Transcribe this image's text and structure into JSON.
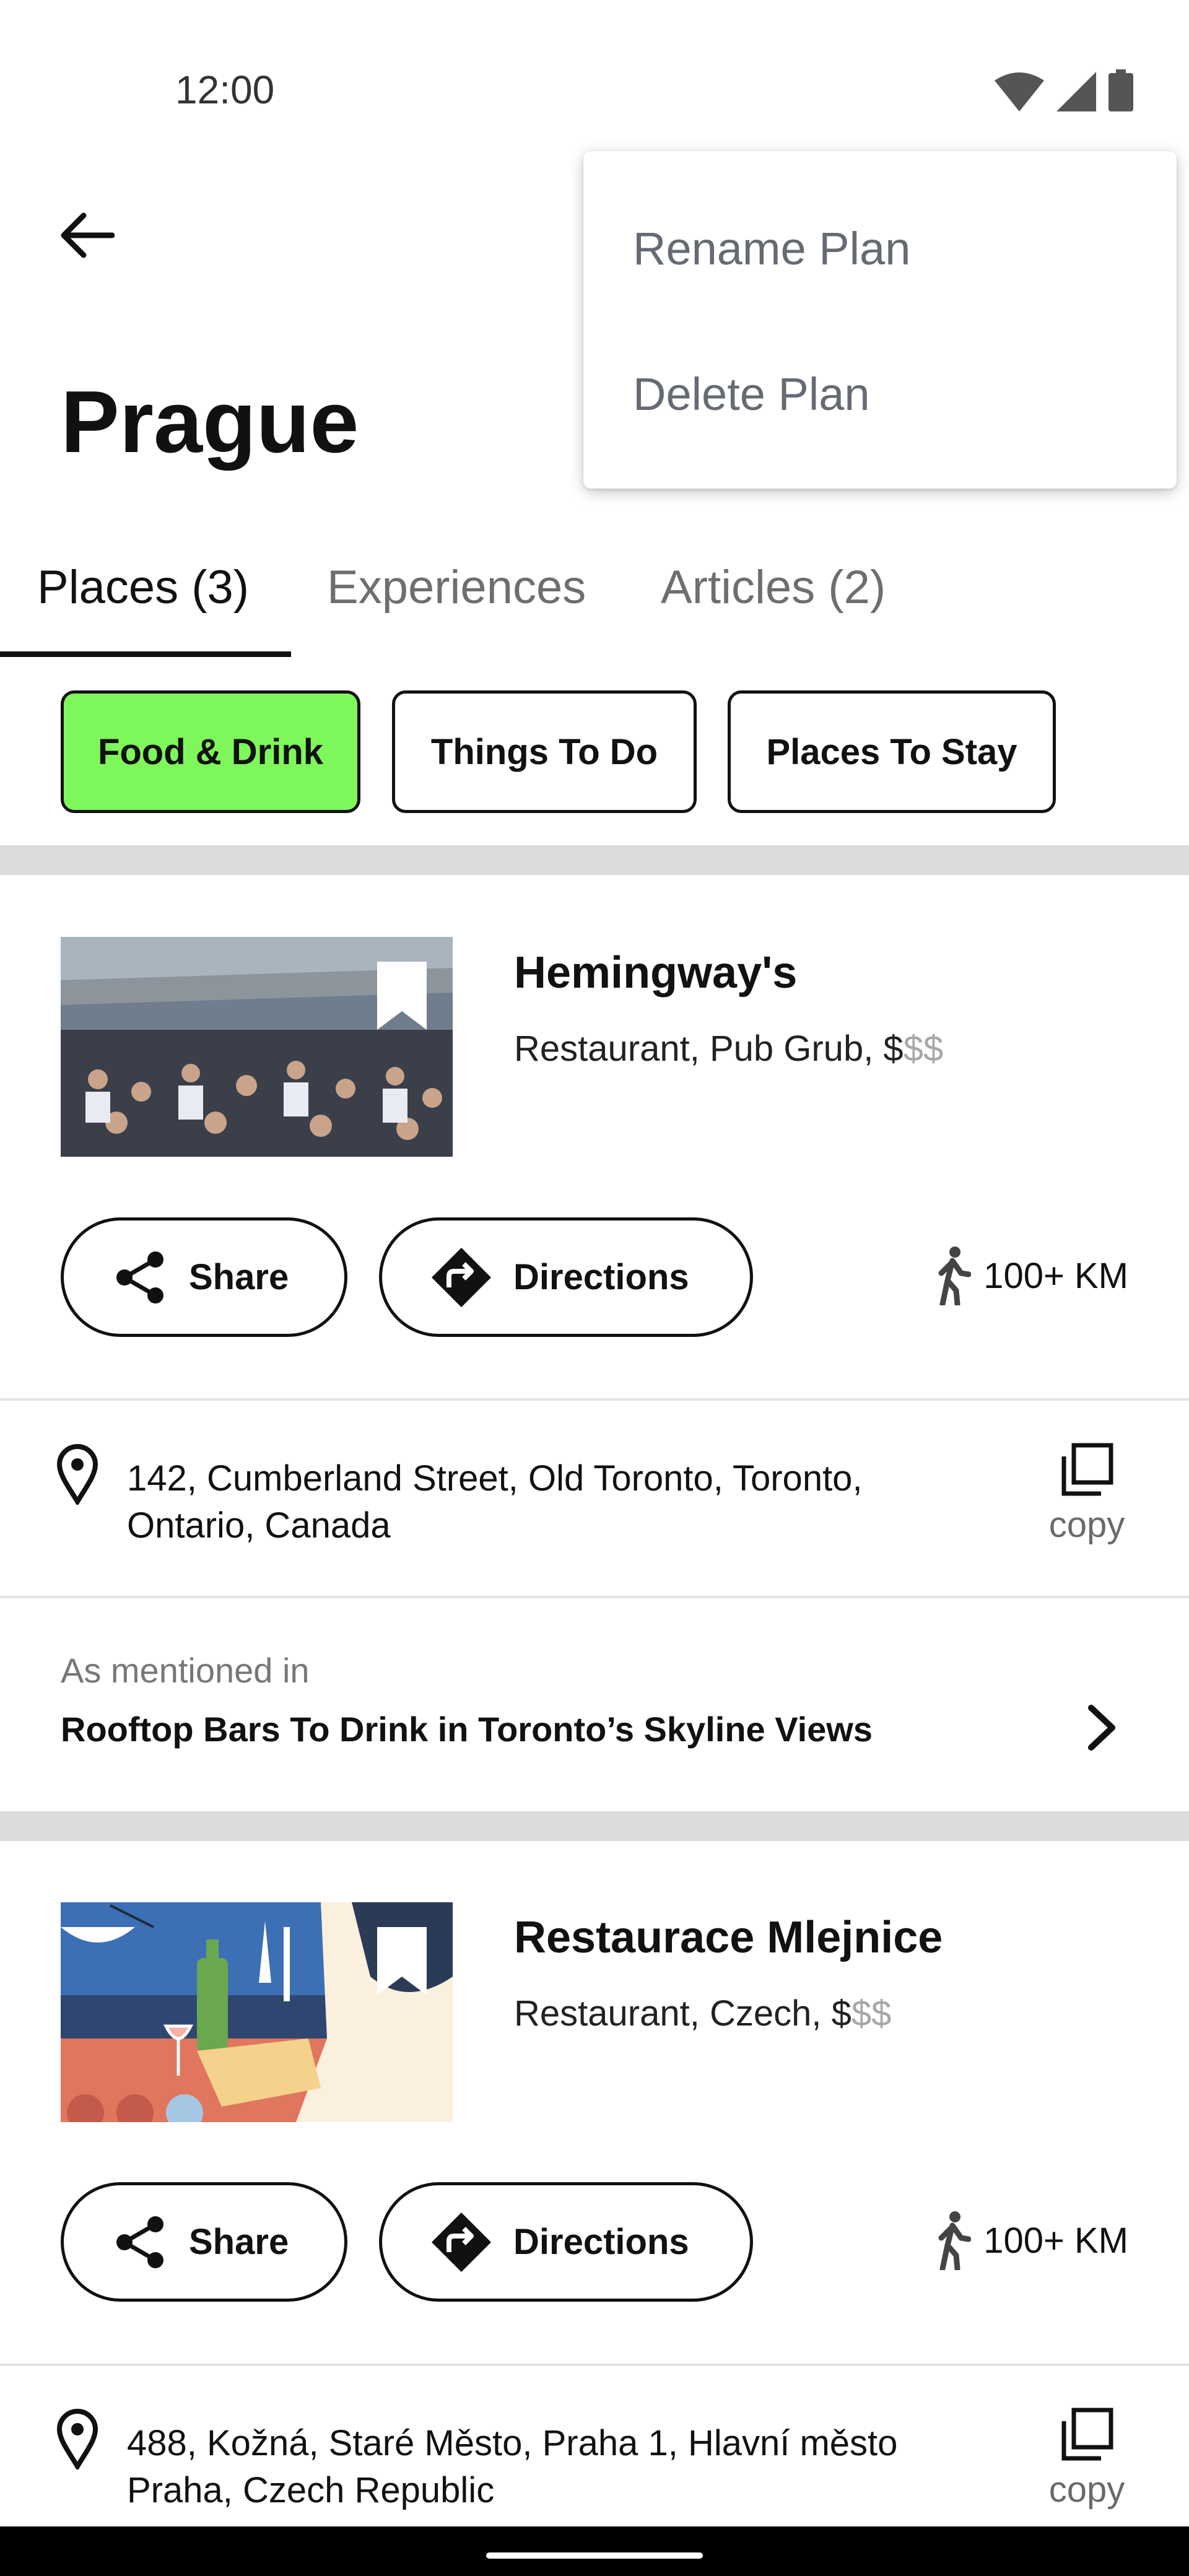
{
  "status_bar": {
    "time": "12:00"
  },
  "page": {
    "title": "Prague"
  },
  "overflow_menu": {
    "items": [
      {
        "label": "Rename Plan"
      },
      {
        "label": "Delete Plan"
      }
    ]
  },
  "tabs": [
    {
      "label": "Places (3)",
      "active": true
    },
    {
      "label": "Experiences",
      "active": false
    },
    {
      "label": "Articles (2)",
      "active": false
    }
  ],
  "filters": [
    {
      "label": "Food & Drink",
      "selected": true
    },
    {
      "label": "Things To Do",
      "selected": false
    },
    {
      "label": "Places To Stay",
      "selected": false
    }
  ],
  "colors": {
    "chip_selected": "#7ef75a",
    "divider": "#dcdcdc",
    "menu_text": "#666a73",
    "price_dim": "#a7a7a7"
  },
  "places": [
    {
      "name": "Hemingway's",
      "meta_prefix": "Restaurant, Pub Grub, $",
      "meta_dim": "$$",
      "share_label": "Share",
      "directions_label": "Directions",
      "distance": "100+ KM",
      "address": "142, Cumberland Street, Old Toronto, Toronto, Ontario, Canada",
      "copy_label": "copy",
      "mention_pre": "As mentioned in",
      "mention_title": "Rooftop Bars To Drink in Toronto’s Skyline Views"
    },
    {
      "name": "Restaurace Mlejnice",
      "meta_prefix": "Restaurant, Czech, $",
      "meta_dim": "$$",
      "share_label": "Share",
      "directions_label": "Directions",
      "distance": "100+ KM",
      "address": "488, Kožná, Staré Město, Praha 1, Hlavní město Praha, Czech Republic",
      "copy_label": "copy"
    }
  ]
}
